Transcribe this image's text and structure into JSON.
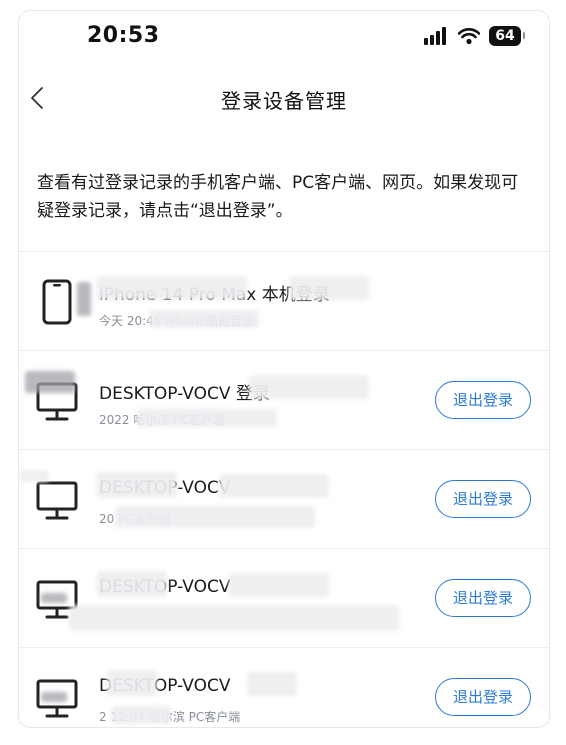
{
  "status_bar": {
    "time": "20:53",
    "battery": "64",
    "icons": [
      "signal-icon",
      "wifi-icon",
      "battery-icon"
    ]
  },
  "nav": {
    "title": "登录设备管理",
    "back_icon": "chevron-left-icon"
  },
  "description": "查看有过登录记录的手机客户端、PC客户端、网页。如果发现可疑登录记录，请点击“退出登录”。",
  "colors": {
    "accent": "#2d7bd8",
    "text_primary": "#1a1a1a",
    "text_secondary": "#8a8f99",
    "divider": "#eeeeee"
  },
  "devices": [
    {
      "icon": "phone-icon",
      "name": "iPhone 14 Pro Max 本机登录",
      "detail": "今天 20:45 iPhone酷狗音乐",
      "action_label": ""
    },
    {
      "icon": "monitor-icon",
      "name": "DESKTOP-VOCV 登录",
      "detail": "2022 哈尔滨 PC客户端",
      "action_label": "退出登录"
    },
    {
      "icon": "monitor-icon",
      "name": "DESKTOP-VOCV",
      "detail": "20 PC客户端",
      "action_label": "退出登录"
    },
    {
      "icon": "monitor-icon",
      "name": "DESKTOP-VOCV",
      "detail": "",
      "action_label": "退出登录"
    },
    {
      "icon": "monitor-icon",
      "name": "DESKTOP-VOCV",
      "detail": "2 12:07 哈尔滨 PC客户端",
      "action_label": "退出登录"
    }
  ]
}
